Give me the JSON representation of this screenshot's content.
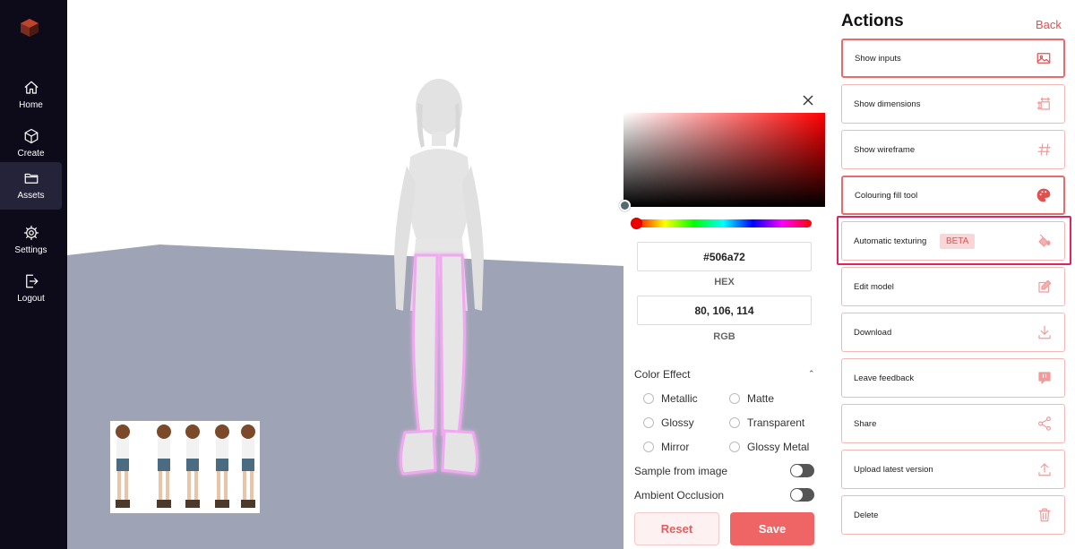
{
  "sidebar": {
    "items": [
      {
        "label": "Home",
        "icon": "home-icon"
      },
      {
        "label": "Create",
        "icon": "cube-icon"
      },
      {
        "label": "Assets",
        "icon": "folder-icon",
        "active": true
      },
      {
        "label": "Settings",
        "icon": "gear-icon"
      },
      {
        "label": "Logout",
        "icon": "logout-icon"
      }
    ]
  },
  "picker": {
    "hex_value": "#506a72",
    "hex_label": "HEX",
    "rgb_value": "80, 106, 114",
    "rgb_label": "RGB",
    "effect_title": "Color Effect",
    "effects": [
      "Metallic",
      "Matte",
      "Glossy",
      "Transparent",
      "Mirror",
      "Glossy Metal"
    ],
    "sample_label": "Sample from image",
    "ao_label": "Ambient Occlusion",
    "reset_label": "Reset",
    "save_label": "Save",
    "selected_color": "#506a72"
  },
  "actions": {
    "title": "Actions",
    "back_label": "Back",
    "items": [
      {
        "label": "Show inputs",
        "icon": "image-icon"
      },
      {
        "label": "Show dimensions",
        "icon": "dimensions-icon"
      },
      {
        "label": "Show wireframe",
        "icon": "hash-icon"
      },
      {
        "label": "Colouring fill tool",
        "icon": "palette-icon"
      },
      {
        "label": "Automatic texturing",
        "icon": "paint-bucket-icon",
        "badge": "BETA"
      },
      {
        "label": "Edit model",
        "icon": "edit-icon"
      },
      {
        "label": "Download",
        "icon": "download-icon"
      },
      {
        "label": "Leave feedback",
        "icon": "feedback-icon"
      },
      {
        "label": "Share",
        "icon": "share-icon"
      },
      {
        "label": "Upload latest version",
        "icon": "upload-icon"
      },
      {
        "label": "Delete",
        "icon": "trash-icon"
      }
    ]
  },
  "colors": {
    "accent": "#ef6565",
    "sidebar_bg": "#0d0b1a",
    "floor": "#9fa3b6",
    "highlight": "#e0245e"
  }
}
